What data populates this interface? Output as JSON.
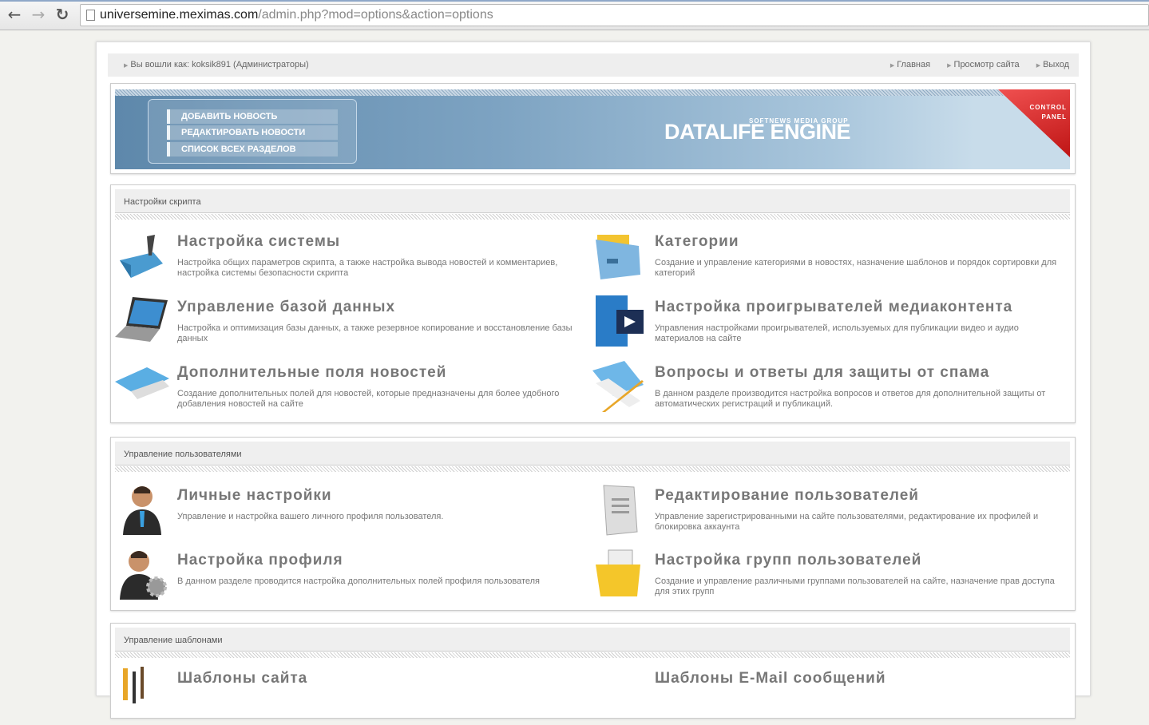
{
  "browser": {
    "url_host": "universemine.meximas.com",
    "url_path": "/admin.php?mod=options&action=options",
    "back": "←",
    "forward": "→",
    "reload": "↻"
  },
  "infobar": {
    "logged_in": "Вы вошли как: koksik891 (Администраторы)",
    "links": [
      "Главная",
      "Просмотр сайта",
      "Выход"
    ]
  },
  "banner": {
    "menu": [
      "ДОБАВИТЬ НОВОСТЬ",
      "РЕДАКТИРОВАТЬ НОВОСТИ",
      "СПИСОК ВСЕХ РАЗДЕЛОВ"
    ],
    "brand_small": "SOFTNEWS MEDIA GROUP",
    "brand": "DATALIFE ENGINE",
    "control": "CONTROL",
    "panel": "PANEL"
  },
  "sections": [
    {
      "title": "Настройки скрипта",
      "items": [
        {
          "title": "Настройка системы",
          "desc": "Настройка общих параметров скрипта, а также настройка вывода новостей и комментариев, настройка системы безопасности скрипта"
        },
        {
          "title": "Категории",
          "desc": "Создание и управление категориями в новостях, назначение шаблонов и порядок сортировки для категорий"
        },
        {
          "title": "Управление базой данных",
          "desc": "Настройка и оптимизация базы данных, а также резервное копирование и восстановление базы данных"
        },
        {
          "title": "Настройка проигрывателей медиаконтента",
          "desc": "Управления настройками проигрывателей, используемых для публикации видео и аудио материалов на сайте"
        },
        {
          "title": "Дополнительные поля новостей",
          "desc": "Создание дополнительных полей для новостей, которые предназначены для более удобного добавления новостей на сайте"
        },
        {
          "title": "Вопросы и ответы для защиты от спама",
          "desc": "В данном разделе производится настройка вопросов и ответов для дополнительной защиты от автоматических регистраций и публикаций."
        }
      ]
    },
    {
      "title": "Управление пользователями",
      "items": [
        {
          "title": "Личные настройки",
          "desc": "Управление и настройка вашего личного профиля пользователя."
        },
        {
          "title": "Редактирование пользователей",
          "desc": "Управление зарегистрированными на сайте пользователями, редактирование их профилей и блокировка аккаунта"
        },
        {
          "title": "Настройка профиля",
          "desc": "В данном разделе проводится настройка дополнительных полей профиля пользователя"
        },
        {
          "title": "Настройка групп пользователей",
          "desc": "Создание и управление различными группами пользователей на сайте, назначение прав доступа для этих групп"
        }
      ]
    },
    {
      "title": "Управление шаблонами",
      "items": [
        {
          "title": "Шаблоны сайта",
          "desc": ""
        },
        {
          "title": "Шаблоны E-Mail сообщений",
          "desc": ""
        }
      ]
    }
  ]
}
